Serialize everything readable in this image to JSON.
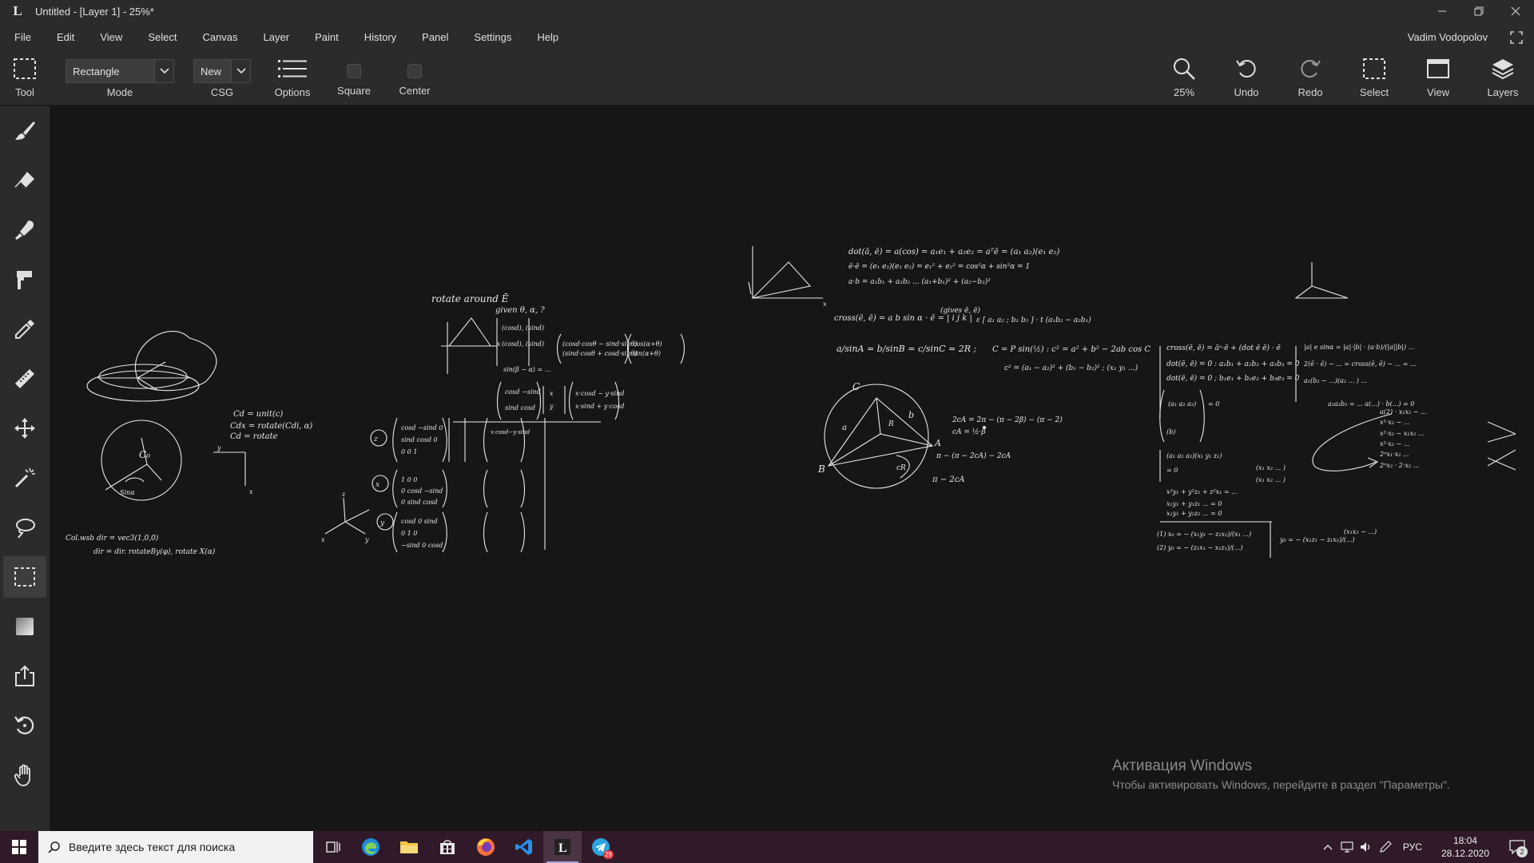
{
  "titlebar": {
    "app_logo": "L",
    "title": "Untitled - [Layer 1] - 25%*"
  },
  "menu": {
    "items": [
      "File",
      "Edit",
      "View",
      "Select",
      "Canvas",
      "Layer",
      "Paint",
      "History",
      "Panel",
      "Settings",
      "Help"
    ],
    "user": "Vadim Vodopolov"
  },
  "toolbar": {
    "tool_label": "Tool",
    "mode_value": "Rectangle",
    "mode_label": "Mode",
    "csg_value": "New",
    "csg_label": "CSG",
    "options_label": "Options",
    "square_label": "Square",
    "center_label": "Center",
    "zoom_label": "25%",
    "undo_label": "Undo",
    "redo_label": "Redo",
    "select_label": "Select",
    "view_label": "View",
    "layers_label": "Layers"
  },
  "toolbox": {
    "tools": [
      "brush-icon",
      "eraser-icon",
      "smudge-icon",
      "fill-icon",
      "eyedropper-icon",
      "ruler-icon",
      "move-icon",
      "magic-wand-icon",
      "lasso-icon",
      "rect-select-icon",
      "gradient-icon",
      "export-icon",
      "rotate-icon",
      "hand-icon"
    ],
    "active": "rect-select-icon"
  },
  "watermark": {
    "title": "Активация Windows",
    "subtitle": "Чтобы активировать Windows, перейдите в раздел \"Параметры\"."
  },
  "taskbar": {
    "search_placeholder": "Введите здесь текст для поиска",
    "language": "РУС",
    "time": "18:04",
    "date": "28.12.2020",
    "notification_count": "2",
    "telegram_badge": "29"
  },
  "colors": {
    "chrome": "#2b2b2b",
    "canvas": "#161616",
    "taskbar": "#301a2a",
    "ink": "#e8e8e8"
  }
}
